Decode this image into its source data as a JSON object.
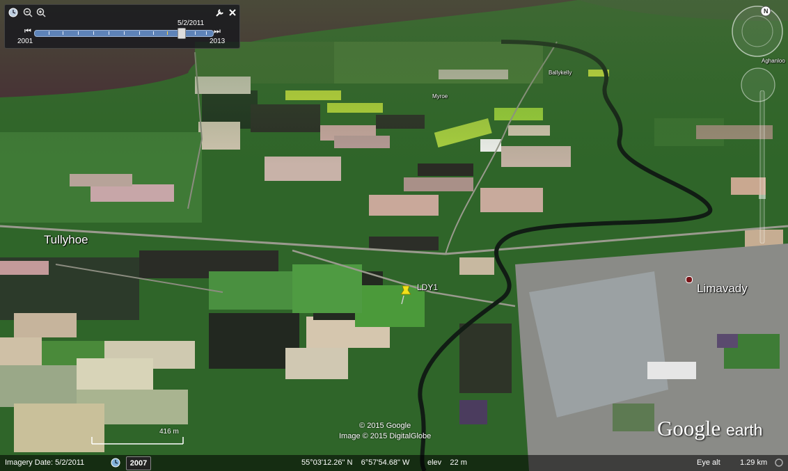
{
  "timeline": {
    "date": "5/2/2011",
    "start_year": "2001",
    "end_year": "2013"
  },
  "places": {
    "tullyhoe": "Tullyhoe",
    "limavady": "Limavady",
    "myroe": "Myroe",
    "ballykelly": "Ballykelly",
    "aghanloo": "Aghanloo",
    "pin_label": "LDY1"
  },
  "attribution": {
    "line1": "© 2015 Google",
    "line2": "Image © 2015 DigitalGlobe"
  },
  "logo": {
    "google": "Google",
    "earth": "earth"
  },
  "scale": {
    "label": "416 m"
  },
  "status": {
    "imagery_date": "Imagery Date: 5/2/2011",
    "year": "2007",
    "coords": "55°03'12.26\" N    6°57'54.68\" W",
    "elev": "elev    22 m",
    "eye_alt_label": "Eye alt",
    "eye_alt_value": "1.29 km"
  },
  "icons": {
    "clock": "clock-icon",
    "zoom_out": "zoom-out-icon",
    "zoom_in": "zoom-in-icon",
    "wrench": "wrench-icon",
    "close": "close-icon",
    "compass": "compass-icon",
    "pin": "pushpin-icon"
  }
}
